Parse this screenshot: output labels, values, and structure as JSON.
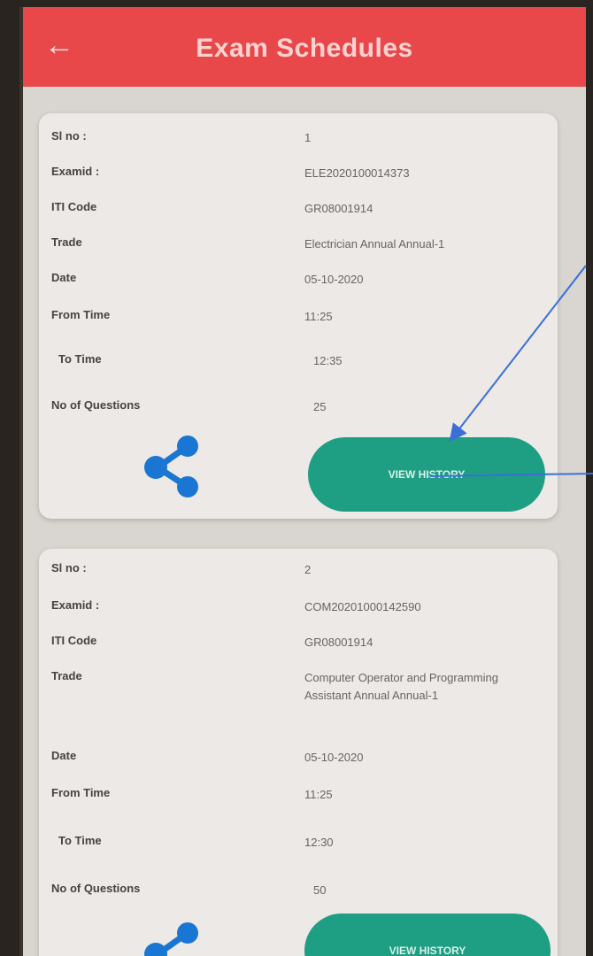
{
  "appbar": {
    "title": "Exam Schedules"
  },
  "labels": {
    "sl_no": "Sl no :",
    "exam_id": "Examid :",
    "iti_code": "ITI Code",
    "trade": "Trade",
    "date": "Date",
    "from_time": "From Time",
    "to_time": "To Time",
    "num_questions": "No of Questions"
  },
  "view_history_label": "VIEW HISTORY",
  "schedules": [
    {
      "sl_no": "1",
      "exam_id": "ELE2020100014373",
      "iti_code": "GR08001914",
      "trade": "Electrician Annual Annual-1",
      "date": "05-10-2020",
      "from_time": "11:25",
      "to_time": "12:35",
      "num_questions": "25"
    },
    {
      "sl_no": "2",
      "exam_id": "COM20201000142590",
      "iti_code": "GR08001914",
      "trade": "Computer Operator and Programming Assistant Annual Annual-1",
      "date": "05-10-2020",
      "from_time": "11:25",
      "to_time": "12:30",
      "num_questions": "50"
    }
  ],
  "colors": {
    "appbar": "#e8484a",
    "button": "#1e9e83",
    "share_icon": "#1976d2",
    "annotation_arrow": "#3a6fd8"
  }
}
